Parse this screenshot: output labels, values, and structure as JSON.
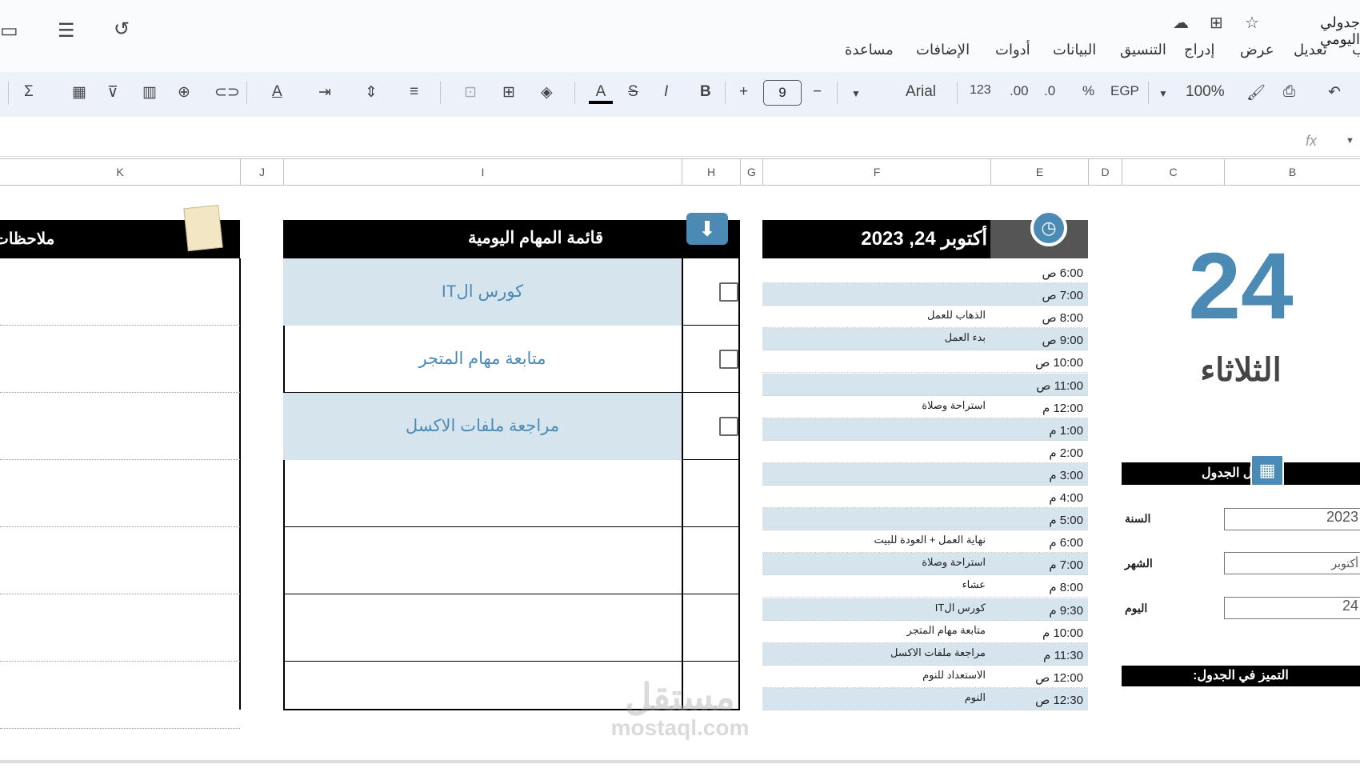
{
  "app": {
    "title": "جدولي اليومي",
    "menu": [
      "تعديل",
      "عرض",
      "إدراج",
      "التنسيق",
      "البيانات",
      "أدوات",
      "الإضافات",
      "مساعدة"
    ]
  },
  "toolbar": {
    "zoom": "100%",
    "currency": "EGP",
    "percent": "%",
    "dec_dec": ".0",
    "inc_dec": ".00",
    "format_123": "123",
    "font": "Arial",
    "font_size": "9"
  },
  "columns": [
    "K",
    "J",
    "I",
    "H",
    "G",
    "F",
    "E",
    "D",
    "C",
    "B"
  ],
  "schedule": {
    "header": "أكتوبر 24, 2023",
    "rows": [
      {
        "time": "6:00 ص",
        "activity": ""
      },
      {
        "time": "7:00 ص",
        "activity": ""
      },
      {
        "time": "8:00 ص",
        "activity": "الذهاب للعمل"
      },
      {
        "time": "9:00 ص",
        "activity": "بدء العمل"
      },
      {
        "time": "10:00 ص",
        "activity": ""
      },
      {
        "time": "11:00 ص",
        "activity": ""
      },
      {
        "time": "12:00 م",
        "activity": "استراحة وصلاة"
      },
      {
        "time": "1:00 م",
        "activity": ""
      },
      {
        "time": "2:00 م",
        "activity": ""
      },
      {
        "time": "3:00 م",
        "activity": ""
      },
      {
        "time": "4:00 م",
        "activity": ""
      },
      {
        "time": "5:00 م",
        "activity": ""
      },
      {
        "time": "6:00 م",
        "activity": "نهاية العمل + العودة للبيت"
      },
      {
        "time": "7:00 م",
        "activity": "استراحة وصلاة"
      },
      {
        "time": "8:00 م",
        "activity": "عشاء"
      },
      {
        "time": "9:30 م",
        "activity": "كورس الIT"
      },
      {
        "time": "10:00 م",
        "activity": "متابعة مهام المتجر"
      },
      {
        "time": "11:30 م",
        "activity": "مراجعة ملفات الاكسل"
      },
      {
        "time": "12:00 ص",
        "activity": "الاستعداد للنوم"
      },
      {
        "time": "12:30 ص",
        "activity": "النوم"
      }
    ]
  },
  "tasks": {
    "header": "قائمة المهام اليومية",
    "items": [
      {
        "text": "كورس الIT",
        "checked": false
      },
      {
        "text": "متابعة مهام المتجر",
        "checked": false
      },
      {
        "text": "مراجعة ملفات الاكسل",
        "checked": false
      },
      {
        "text": ""
      },
      {
        "text": ""
      },
      {
        "text": ""
      },
      {
        "text": ""
      }
    ]
  },
  "notes": {
    "header": "ملاحظات"
  },
  "date_panel": {
    "day_number": "24",
    "day_name": "الثلاثاء",
    "settings_header": "ل الجدول",
    "year_label": "السنة",
    "year": "2023",
    "month_label": "الشهر",
    "month": "أكتوبر",
    "day_label": "اليوم",
    "day": "24",
    "highlight_header": "التميز في الجدول:"
  },
  "watermark": {
    "arabic": "مستقل",
    "latin": "mostaql.com"
  },
  "colors": {
    "accent": "#4a8ab5",
    "band": "#d6e4ee"
  }
}
